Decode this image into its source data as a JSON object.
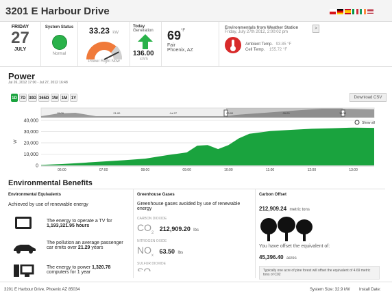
{
  "header": {
    "title": "3201 E Harbour Drive"
  },
  "date": {
    "day_name": "FRIDAY",
    "day_num": "27",
    "month": "JULY"
  },
  "system_status": {
    "label": "System Status",
    "value": "Normal"
  },
  "power_now": {
    "value": "33.23",
    "unit": "kW",
    "caption": "Power Right Now",
    "gauge_level": 0.85
  },
  "today_gen": {
    "label": "Today",
    "sublabel": "Generation",
    "value": "136.00",
    "unit": "kWh"
  },
  "weather": {
    "temp": "69",
    "unit": "°F",
    "condition": "Fair",
    "location": "Phoenix, AZ"
  },
  "environmentals": {
    "title": "Environmentals from Weather Station",
    "datetime": "Friday, July 27th 2012, 2:00:02 pm",
    "ambient_label": "Ambient Temp.",
    "ambient_value": "93.85 °F",
    "cell_label": "Cell Temp.",
    "cell_value": "155.72 °F",
    "next_label": ">"
  },
  "power": {
    "title": "Power",
    "subtitle": "Jul 26, 2012 17:00 - Jul 27, 2012 16:48",
    "ranges": [
      "1D",
      "7D",
      "30D",
      "365D",
      "1W",
      "1M",
      "1Y"
    ],
    "active_range": "1D",
    "download_label": "Download CSV",
    "show_all": "Show all"
  },
  "chart_data": {
    "type": "area",
    "title": "",
    "xlabel": "",
    "ylabel": "W",
    "ylim": [
      0,
      40000
    ],
    "yticks": [
      "40,000",
      "30,000",
      "20,000",
      "10,000",
      "0"
    ],
    "xticks": [
      "06:00",
      "07:00",
      "08:00",
      "09:00",
      "10:00",
      "11:00",
      "12:00",
      "13:00"
    ],
    "nav_ticks": [
      "15:00",
      "21:00",
      "Jul 27",
      "03:00",
      "09:00",
      "15:00"
    ],
    "series": [
      {
        "x": [
          "05:30",
          "06:00",
          "06:30",
          "07:00",
          "07:30",
          "08:00",
          "08:30",
          "09:00",
          "09:15",
          "09:30",
          "09:45",
          "10:00",
          "10:15",
          "10:30",
          "11:00",
          "11:30",
          "12:00",
          "12:30",
          "13:00",
          "13:30"
        ],
        "values": [
          500,
          1200,
          2300,
          3500,
          4600,
          6000,
          9000,
          11500,
          17500,
          18000,
          14500,
          18000,
          24000,
          28000,
          30500,
          31500,
          32500,
          33000,
          33500,
          33300
        ]
      }
    ],
    "color": "#1aa33e"
  },
  "env_benefits": {
    "title": "Environmental Benefits",
    "col1": {
      "title": "Environmental Equivalents",
      "subtitle": "Achieved by use of renewable energy",
      "items": [
        {
          "text": "The energy to operate a TV for",
          "value": "1,193,321.95 hours"
        },
        {
          "text": "The pollution an average passenger car emits over",
          "value": "21.29",
          "suffix": "years"
        },
        {
          "text": "The energy to power",
          "value": "1,320.78",
          "suffix": "computers for 1 year"
        }
      ]
    },
    "col2": {
      "title": "Greenhouse Gases",
      "subtitle": "Greenhouse gases avoided by use of renewable energy",
      "co2_label": "CARBON DIOXIDE",
      "co2_symbol": "CO",
      "co2_sub": "2",
      "co2_value": "212,909.20",
      "co2_unit": "lbs",
      "nox_label": "NITROGEN OXIDE",
      "nox_symbol": "NO",
      "nox_sub": "x",
      "nox_value": "63.50",
      "nox_unit": "lbs",
      "sox_label": "SULFUR DIOXIDE",
      "sox_symbol": "SO"
    },
    "col3": {
      "title": "Carbon Offset",
      "value": "212,909.24",
      "unit": "metric tons",
      "offset_text": "You have offset the equivalent of:",
      "acres": "45,396.40",
      "acres_unit": "acres",
      "note": "Typically one acre of pine forest will offset the equivalent of 4.69 metric tons of C02"
    }
  },
  "footer": {
    "address": "3201 E Harbour Drive, Phoenix AZ 85034",
    "system_size": "System Size: 32.9 kW",
    "install": "Install Date:"
  }
}
